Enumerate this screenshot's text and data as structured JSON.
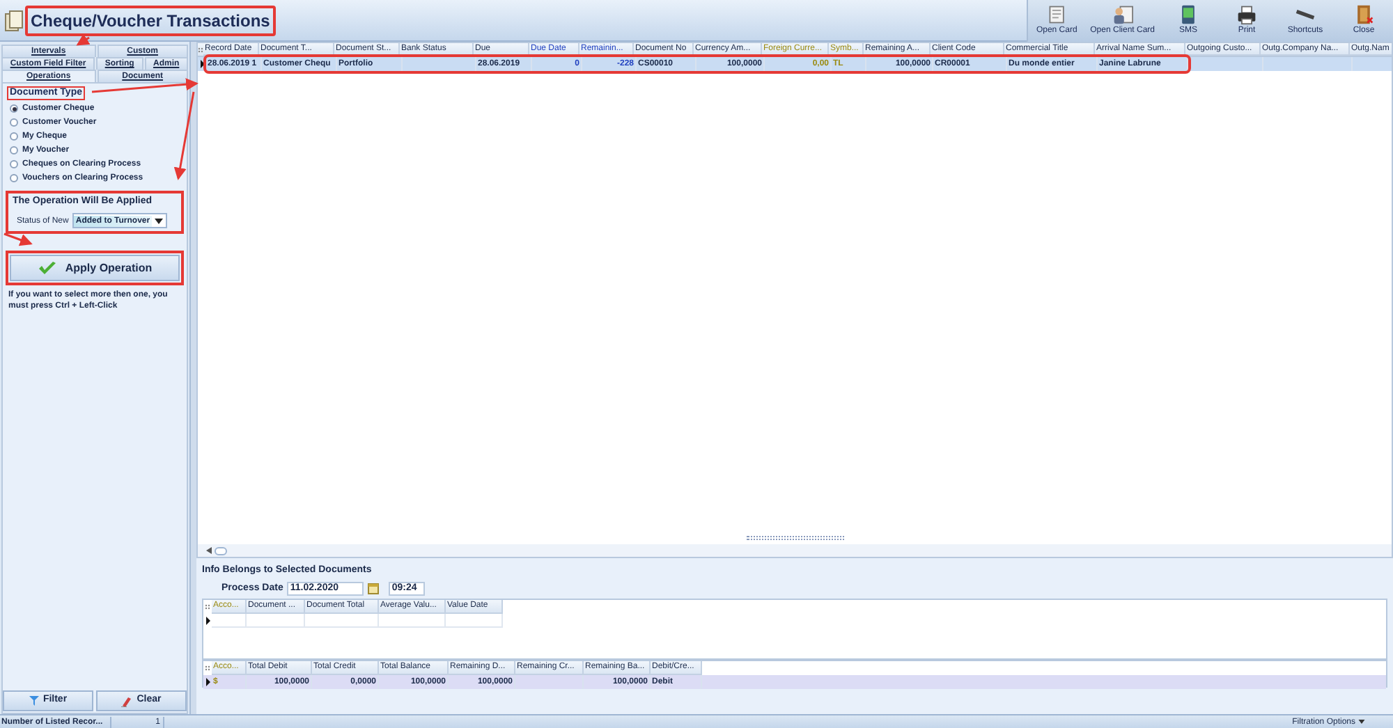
{
  "window": {
    "title": "Cheque/Voucher Transactions"
  },
  "toolbar": [
    {
      "label": "Open Card",
      "kind": "card"
    },
    {
      "label": "Open Client Card",
      "kind": "client"
    },
    {
      "label": "SMS",
      "kind": "sms"
    },
    {
      "label": "Print",
      "kind": "print"
    },
    {
      "label": "Shortcuts",
      "kind": "shortcut"
    },
    {
      "label": "Close",
      "kind": "close"
    }
  ],
  "tab_rows": [
    [
      {
        "label": "Intervals",
        "selected": false
      },
      {
        "label": "Custom",
        "selected": false
      }
    ],
    [
      {
        "label": "Custom Field Filter",
        "selected": false
      },
      {
        "label": "Sorting",
        "selected": false
      },
      {
        "label": "Admin",
        "selected": false
      }
    ],
    [
      {
        "label": "Operations",
        "selected": true
      },
      {
        "label": "Document",
        "selected": false
      }
    ]
  ],
  "document_type": {
    "label": "Document Type",
    "options": [
      {
        "label": "Customer Cheque",
        "selected": true
      },
      {
        "label": "Customer Voucher",
        "selected": false
      },
      {
        "label": "My Cheque",
        "selected": false
      },
      {
        "label": "My Voucher",
        "selected": false
      },
      {
        "label": "Cheques on Clearing Process",
        "selected": false
      },
      {
        "label": "Vouchers on Clearing Process",
        "selected": false
      }
    ]
  },
  "operation_group": {
    "title": "The Operation Will Be Applied",
    "field_label": "Status of New",
    "value": "Added to Turnover"
  },
  "apply_button": "Apply Operation",
  "hint": "If you want to select more then one, you must press Ctrl + Left-Click",
  "filter_button": "Filter",
  "clear_button": "Clear",
  "grid": {
    "columns": [
      {
        "label": "Record Date"
      },
      {
        "label": "Document T..."
      },
      {
        "label": "Document St..."
      },
      {
        "label": "Bank Status"
      },
      {
        "label": "Due"
      },
      {
        "label": "Due Date",
        "color": "#1f3fbf"
      },
      {
        "label": "Remainin...",
        "color": "#1f3fbf"
      },
      {
        "label": "Document No"
      },
      {
        "label": "Currency Am..."
      },
      {
        "label": "Foreign Curre...",
        "color": "#9a8a10"
      },
      {
        "label": "Symb...",
        "color": "#9a8a10"
      },
      {
        "label": "Remaining A..."
      },
      {
        "label": "Client Code"
      },
      {
        "label": "Commercial Title"
      },
      {
        "label": "Arrival Name Sum..."
      },
      {
        "label": "Outgoing Custo..."
      },
      {
        "label": "Outg.Company Na..."
      },
      {
        "label": "Outg.Nam"
      }
    ],
    "rows": [
      {
        "selected": true,
        "cells": [
          "28.06.2019 1",
          "Customer Chequ",
          "Portfolio",
          "",
          "28.06.2019",
          "0",
          "-228",
          "CS00010",
          "100,0000",
          "0,00",
          "TL",
          "100,0000",
          "CR00001",
          "Du monde entier",
          "Janine Labrune",
          "",
          "",
          ""
        ]
      }
    ]
  },
  "info": {
    "title": "Info Belongs to Selected Documents",
    "date_label": "Process Date",
    "date": "11.02.2020",
    "time": "09:24"
  },
  "detail_grid": {
    "columns": [
      {
        "label": "Acco...",
        "color": "#9a8a10"
      },
      {
        "label": "Document ..."
      },
      {
        "label": "Document Total"
      },
      {
        "label": "Average Valu..."
      },
      {
        "label": "Value Date"
      }
    ]
  },
  "totals_grid": {
    "columns": [
      {
        "label": "Acco...",
        "color": "#9a8a10"
      },
      {
        "label": "Total Debit"
      },
      {
        "label": "Total Credit"
      },
      {
        "label": "Total Balance"
      },
      {
        "label": "Remaining D..."
      },
      {
        "label": "Remaining Cr..."
      },
      {
        "label": "Remaining Ba..."
      },
      {
        "label": "Debit/Cre..."
      }
    ],
    "rows": [
      {
        "selected": false,
        "cells": [
          "$",
          "100,0000",
          "0,0000",
          "100,0000",
          "100,0000",
          "",
          "100,0000",
          "Debit"
        ]
      }
    ]
  },
  "status_bar": {
    "label": "Number of Listed Recor...",
    "count": "1",
    "filtration": "Filtration Options"
  }
}
